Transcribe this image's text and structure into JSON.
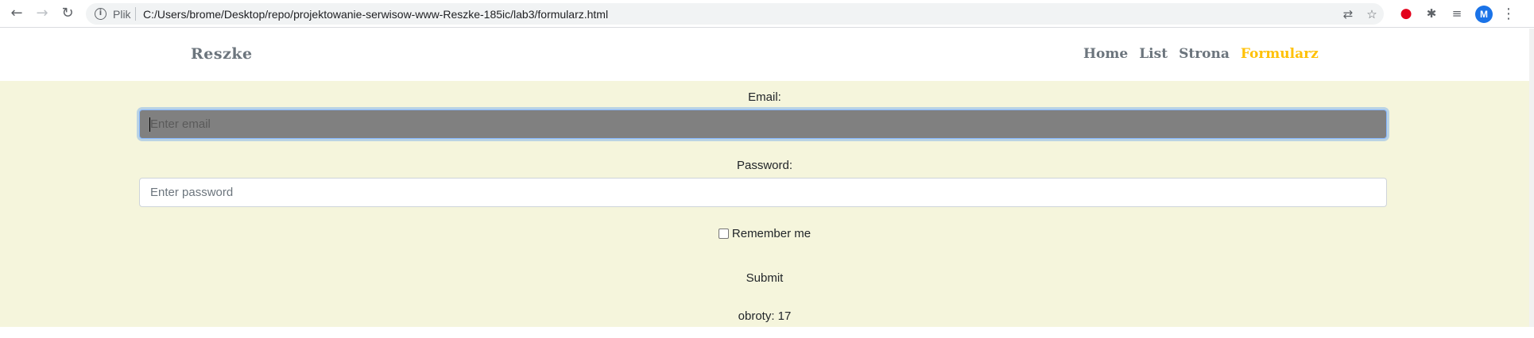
{
  "browser": {
    "back_icon": "←",
    "forward_icon": "→",
    "reload_icon": "↻",
    "info_icon": "i",
    "scheme_label": "Plik",
    "url": "C:/Users/brome/Desktop/repo/projektowanie-serwisow-www-Reszke-185ic/lab3/formularz.html",
    "translate_icon": "⇄",
    "star_icon": "☆",
    "opera_icon": "●",
    "puzzle_icon": "✱",
    "playlist_icon": "≡",
    "avatar_letter": "M",
    "menu_icon": "⋮"
  },
  "header": {
    "brand": "Reszke",
    "nav": [
      {
        "label": "Home",
        "active": false
      },
      {
        "label": "List",
        "active": false
      },
      {
        "label": "Strona",
        "active": false
      },
      {
        "label": "Formularz",
        "active": true
      }
    ]
  },
  "form": {
    "email_label": "Email:",
    "email_placeholder": "Enter email",
    "password_label": "Password:",
    "password_placeholder": "Enter password",
    "remember_label": "Remember me",
    "submit_label": "Submit",
    "counter_text": "obroty: 17"
  },
  "colors": {
    "background": "#f5f5dc",
    "nav_active": "#ffc107",
    "nav_default": "#6c757d",
    "focused_input": "#808080"
  }
}
